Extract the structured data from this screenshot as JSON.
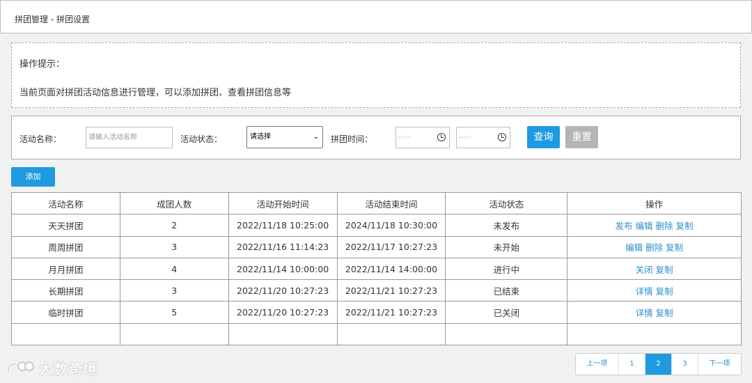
{
  "breadcrumb": "拼团管理 - 拼团设置",
  "tips": {
    "title": "操作提示：",
    "text": "当前页面对拼团活动信息进行管理，可以添加拼团、查看拼团信息等"
  },
  "filter": {
    "name_label": "活动名称：",
    "name_placeholder": "请输入活动名称",
    "status_label": "活动状态：",
    "status_value": "请选择",
    "time_label": "拼团时间：",
    "time_start": "--:--",
    "time_end": "--:--",
    "query_label": "查询",
    "reset_label": "重置"
  },
  "add_label": "添加",
  "table": {
    "headers": [
      "活动名称",
      "成团人数",
      "活动开始时间",
      "活动结束时间",
      "活动状态",
      "操作"
    ],
    "rows": [
      {
        "name": "天天拼团",
        "count": "2",
        "start": "2022/11/18 10:25:00",
        "end": "2024/11/18 10:30:00",
        "status": "未发布",
        "ops": [
          "发布",
          "编辑",
          "删除",
          "复制"
        ]
      },
      {
        "name": "周周拼团",
        "count": "3",
        "start": "2022/11/16 11:14:23",
        "end": "2022/11/17 10:27:23",
        "status": "未开始",
        "ops": [
          "编辑",
          "删除",
          "复制"
        ]
      },
      {
        "name": "月月拼团",
        "count": "4",
        "start": "2022/11/14 10:00:00",
        "end": "2022/11/14 14:00:00",
        "status": "进行中",
        "ops": [
          "关闭",
          "复制"
        ]
      },
      {
        "name": "长期拼团",
        "count": "3",
        "start": "2022/11/20 10:27:23",
        "end": "2022/11/21 10:27:23",
        "status": "已结束",
        "ops": [
          "详情",
          "复制"
        ]
      },
      {
        "name": "临时拼团",
        "count": "5",
        "start": "2022/11/20 10:27:23",
        "end": "2022/11/21 10:27:23",
        "status": "已关闭",
        "ops": [
          "详情",
          "复制"
        ]
      }
    ]
  },
  "pager": {
    "prev": "上一项",
    "pages": [
      "1",
      "2",
      "3"
    ],
    "active_page": "2",
    "next": "下一项"
  },
  "watermark": "大数跨境",
  "colors": {
    "primary": "#1e9be0",
    "link": "#2b8fcf",
    "reset": "#b5b5b5"
  }
}
